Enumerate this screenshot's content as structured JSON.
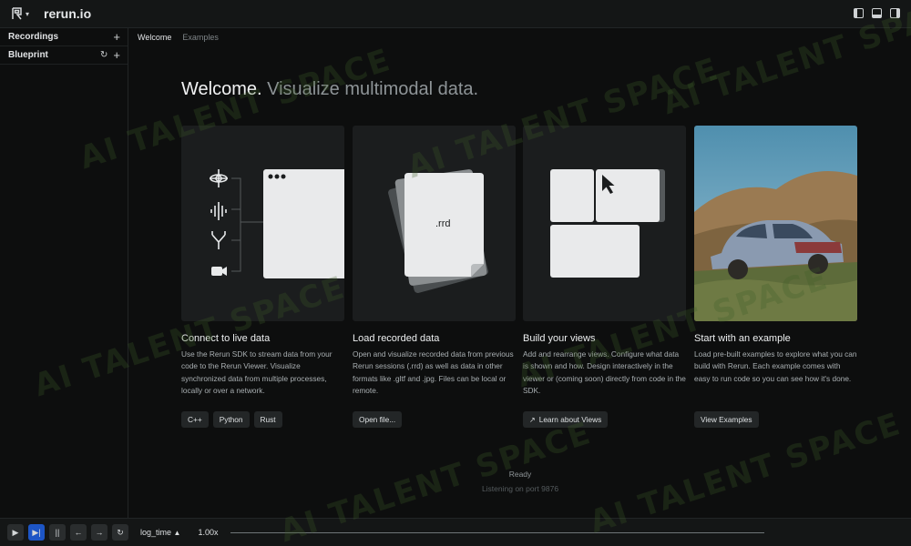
{
  "app": {
    "title": "rerun.io"
  },
  "left_panel": {
    "recordings_label": "Recordings",
    "blueprint_label": "Blueprint"
  },
  "tabs": [
    {
      "label": "Welcome",
      "active": true
    },
    {
      "label": "Examples",
      "active": false
    }
  ],
  "welcome": {
    "headline_main": "Welcome.",
    "headline_sub": "Visualize multimodal data.",
    "cards": [
      {
        "title": "Connect to live data",
        "description": "Use the Rerun SDK to stream data from your code to the Rerun Viewer. Visualize synchronized data from multiple processes, locally or over a network.",
        "buttons": [
          "C++",
          "Python",
          "Rust"
        ]
      },
      {
        "title": "Load recorded data",
        "description": "Open and visualize recorded data from previous Rerun sessions (.rrd) as well as data in other formats like .gltf and .jpg. Files can be local or remote.",
        "file_label": ".rrd",
        "buttons": [
          "Open file..."
        ]
      },
      {
        "title": "Build your views",
        "description": "Add and rearrange views. Configure what data is shown and how. Design interactively in the viewer or (coming soon) directly from code in the SDK.",
        "buttons": [
          "Learn about Views"
        ]
      },
      {
        "title": "Start with an example",
        "description": "Load pre-built examples to explore what you can build with Rerun. Each example comes with easy to run code so you can see how it's done.",
        "buttons": [
          "View Examples"
        ]
      }
    ],
    "status_ready": "Ready",
    "status_listening": "Listening on port 9876"
  },
  "timebar": {
    "timeline": "log_time",
    "speed": "1.00x"
  },
  "watermark": "AI TALENT SPACE",
  "colors": {
    "accent": "#1d55c5",
    "background": "#0d0e0e"
  }
}
